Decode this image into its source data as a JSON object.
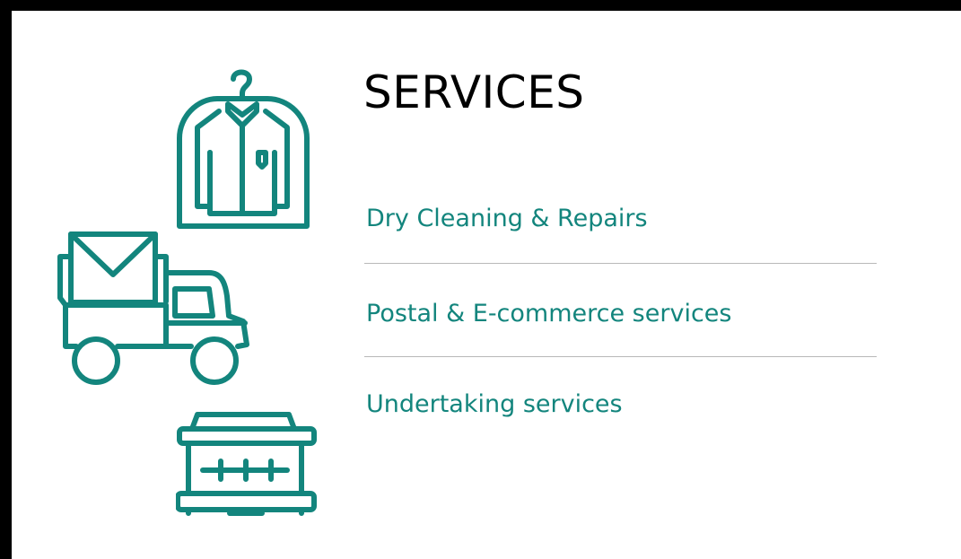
{
  "section": {
    "title": "SERVICES"
  },
  "services": [
    {
      "label": "Dry Cleaning & Repairs",
      "icon": "garment-bag-icon"
    },
    {
      "label": "Postal & E-commerce services",
      "icon": "delivery-truck-icon"
    },
    {
      "label": "Undertaking services",
      "icon": "coffin-icon"
    }
  ],
  "colors": {
    "accent": "#13857d",
    "heading": "#000000",
    "divider": "#b8b8b8"
  }
}
